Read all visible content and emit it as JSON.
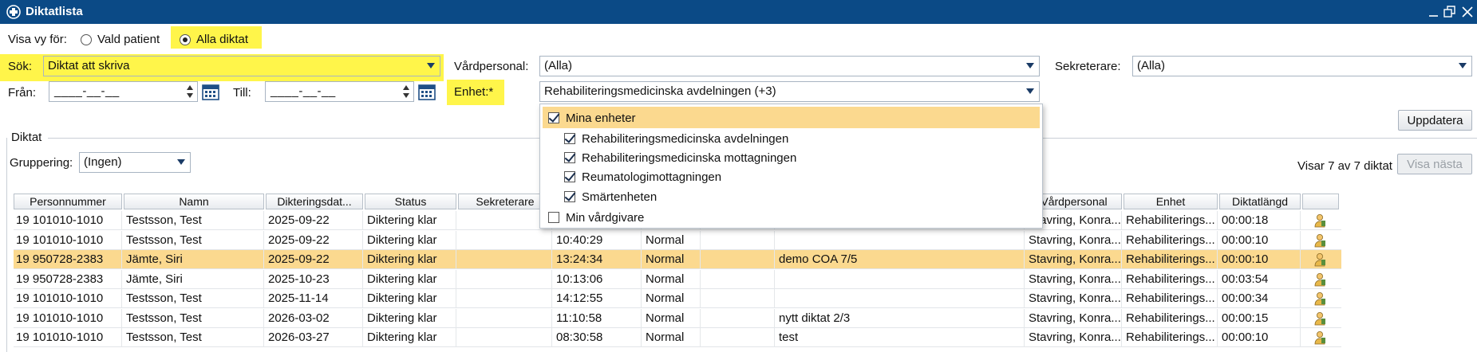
{
  "window": {
    "title": "Diktatlista"
  },
  "view": {
    "label": "Visa vy för:",
    "option_patient": "Vald patient",
    "option_all": "Alla diktat"
  },
  "filters": {
    "search_label": "Sök:",
    "search_value": "Diktat att skriva",
    "from_label": "Från:",
    "from_value": "____-__-__",
    "to_label": "Till:",
    "to_value": "____-__-__",
    "unit_label": "Enhet:*",
    "unit_value": "Rehabiliteringsmedicinska avdelningen (+3)",
    "careprof_label": "Vårdpersonal:",
    "careprof_value": "(Alla)",
    "secretary_label": "Sekreterare:",
    "secretary_value": "(Alla)"
  },
  "unit_dropdown": {
    "header": "Mina enheter",
    "items": [
      "Rehabiliteringsmedicinska avdelningen",
      "Rehabiliteringsmedicinska mottagningen",
      "Reumatologimottagningen",
      "Smärtenheten"
    ],
    "footer": "Min vårdgivare"
  },
  "actions": {
    "update": "Uppdatera",
    "show_next": "Visa nästa"
  },
  "dictations": {
    "group_title": "Diktat",
    "grouping_label": "Gruppering:",
    "grouping_value": "(Ingen)",
    "count_text": "Visar 7 av 7 diktat"
  },
  "table": {
    "columns": [
      "Personnummer",
      "Namn",
      "Dikteringsdat...",
      "Status",
      "Sekreterare",
      "",
      "",
      "",
      "",
      "Vårdpersonal",
      "Enhet",
      "Diktatlängd",
      ""
    ],
    "rows": [
      [
        "19 101010-1010",
        "Testsson, Test",
        "2025-09-22",
        "Diktering klar",
        "",
        "",
        "",
        "",
        "",
        "Stavring, Konra...",
        "Rehabiliterings...",
        "00:00:18"
      ],
      [
        "19 101010-1010",
        "Testsson, Test",
        "2025-09-22",
        "Diktering klar",
        "",
        "10:40:29",
        "Normal",
        "",
        "",
        "Stavring, Konra...",
        "Rehabiliterings...",
        "00:00:10"
      ],
      [
        "19 950728-2383",
        "Jämte, Siri",
        "2025-09-22",
        "Diktering klar",
        "",
        "13:24:34",
        "Normal",
        "",
        "demo COA 7/5",
        "Stavring, Konra...",
        "Rehabiliterings...",
        "00:00:10"
      ],
      [
        "19 950728-2383",
        "Jämte, Siri",
        "2025-10-23",
        "Diktering klar",
        "",
        "10:13:06",
        "Normal",
        "",
        "",
        "Stavring, Konra...",
        "Rehabiliterings...",
        "00:03:54"
      ],
      [
        "19 101010-1010",
        "Testsson, Test",
        "2025-11-14",
        "Diktering klar",
        "",
        "14:12:55",
        "Normal",
        "",
        "",
        "Stavring, Konra...",
        "Rehabiliterings...",
        "00:00:34"
      ],
      [
        "19 101010-1010",
        "Testsson, Test",
        "2026-03-02",
        "Diktering klar",
        "",
        "11:10:58",
        "Normal",
        "",
        "nytt diktat  2/3",
        "Stavring, Konra...",
        "Rehabiliterings...",
        "00:00:15"
      ],
      [
        "19 101010-1010",
        "Testsson, Test",
        "2026-03-27",
        "Diktering klar",
        "",
        "08:30:58",
        "Normal",
        "",
        "test",
        "Stavring, Konra...",
        "Rehabiliterings...",
        "00:00:10"
      ]
    ],
    "selected_row": 2
  },
  "colors": {
    "titlebar": "#0b4a86",
    "highlight": "#fff54a",
    "selection": "#fbd98f"
  }
}
